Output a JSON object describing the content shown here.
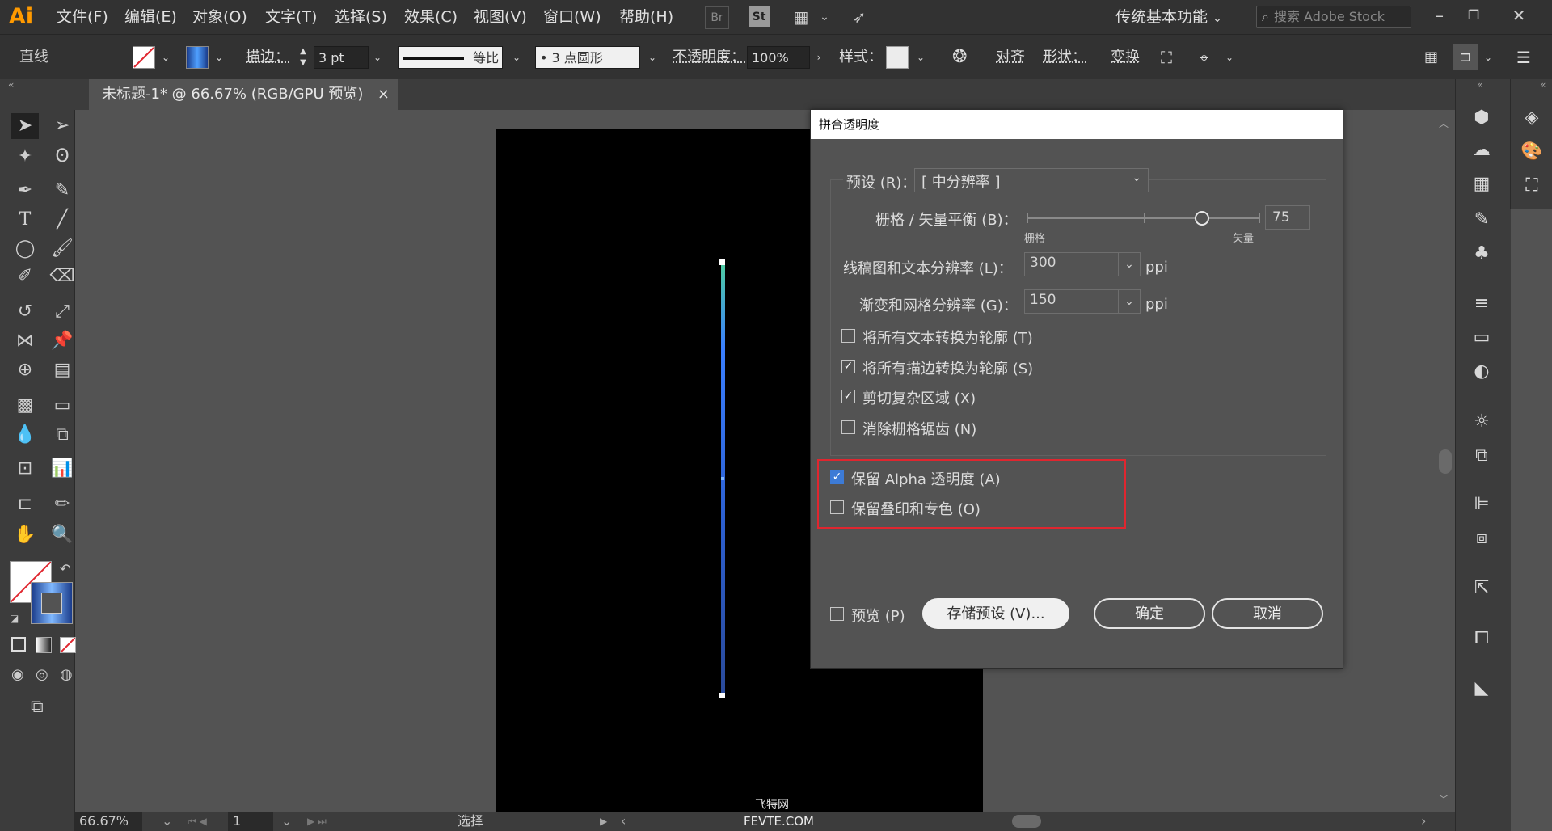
{
  "app": {
    "logo": "Ai",
    "workspace": "传统基本功能",
    "search_placeholder": "搜索 Adobe Stock",
    "bridge": "Br",
    "stock": "St"
  },
  "menus": [
    "文件(F)",
    "编辑(E)",
    "对象(O)",
    "文字(T)",
    "选择(S)",
    "效果(C)",
    "视图(V)",
    "窗口(W)",
    "帮助(H)"
  ],
  "control_bar": {
    "selection": "直线",
    "stroke_label": "描边：",
    "stroke_weight": "3 pt",
    "profile": "等比",
    "brush": "•  3 点圆形",
    "opacity_label": "不透明度：",
    "opacity": "100%",
    "style_label": "样式：",
    "align": "对齐",
    "shape": "形状：",
    "transform": "变换"
  },
  "document": {
    "tab_title": "未标题-1* @ 66.67% (RGB/GPU 预览)",
    "close": "×"
  },
  "status": {
    "zoom": "66.67%",
    "page": "1",
    "tool": "选择"
  },
  "watermark": {
    "line1": "飞特网",
    "line2": "FEVTE.COM"
  },
  "dialog": {
    "title": "拼合透明度",
    "preset_label": "预设 (R)：",
    "preset_value": "[ 中分辨率 ]",
    "balance_label": "栅格 / 矢量平衡 (B)：",
    "balance_value": "75",
    "balance_fraction": 0.75,
    "balance_left": "栅格",
    "balance_right": "矢量",
    "line_res_label": "线稿图和文本分辨率 (L)：",
    "line_res_value": "300",
    "grad_res_label": "渐变和网格分辨率 (G)：",
    "grad_res_value": "150",
    "unit": "ppi",
    "options": [
      {
        "label": "将所有文本转换为轮廓 (T)",
        "checked": false
      },
      {
        "label": "将所有描边转换为轮廓 (S)",
        "checked": true
      },
      {
        "label": "剪切复杂区域 (X)",
        "checked": true
      },
      {
        "label": "消除栅格锯齿 (N)",
        "checked": false
      }
    ],
    "alpha_label": "保留 Alpha 透明度 (A)",
    "alpha_checked": true,
    "overprint_label": "保留叠印和专色 (O)",
    "overprint_checked": false,
    "preview_label": "预览 (P)",
    "save_preset": "存储预设 (V)...",
    "ok": "确定",
    "cancel": "取消"
  },
  "colors": {
    "highlight": "#e0262f",
    "accent": "#3d7bd6",
    "logo": "#ff9a00"
  }
}
